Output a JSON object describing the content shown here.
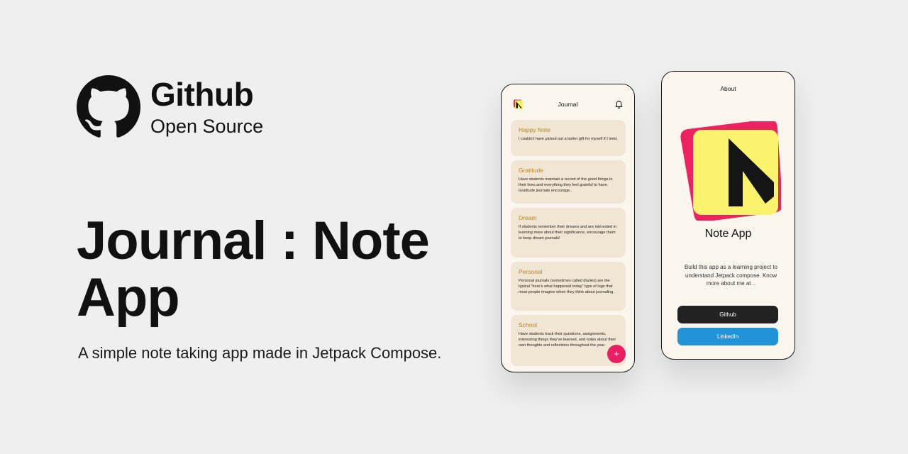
{
  "brand": {
    "title": "Github",
    "subtitle": "Open Source"
  },
  "hero": {
    "title_line1": "Journal : Note",
    "title_line2": "App",
    "description": "A simple note taking app made in Jetpack Compose."
  },
  "journal_screen": {
    "title": "Journal",
    "fab_label": "+",
    "notes": [
      {
        "title": "Happy Note",
        "body": "I couldn't have picked out a better gift for myself if I tried."
      },
      {
        "title": "Gratitude",
        "body": "Have students maintain a record of the good things in their lives and everything they feel grateful to have. Gratitude journals encourage.."
      },
      {
        "title": "Dream",
        "body": "If students remember their dreams and are interested in learning more about their significance, encourage them to keep dream journals!"
      },
      {
        "title": "Personal",
        "body": "Personal journals (sometimes called diaries) are the typical \"here's what happened today\" type of logs that most people imagine when they think about journaling."
      },
      {
        "title": "School",
        "body": "Have students track their questions, assignments, interesting things they've learned, and notes about their own thoughts and reflections throughout the year."
      }
    ]
  },
  "about_screen": {
    "title": "About",
    "app_name": "Note App",
    "description": "Build this app as a learning project to understand Jetpack compose. Know more about me at ..",
    "buttons": {
      "github": "Github",
      "linkedin": "LinkedIn"
    }
  },
  "colors": {
    "background": "#efefef",
    "note_card": "#f0e6d3",
    "note_title": "#b7862a",
    "fab": "#e91e63",
    "github_button": "#222222",
    "linkedin_button": "#2193d6",
    "logo_yellow": "#fbf36b",
    "logo_pink": "#ec2360"
  },
  "icons": [
    "github-icon",
    "app-logo-icon",
    "bell-icon",
    "plus-icon"
  ]
}
